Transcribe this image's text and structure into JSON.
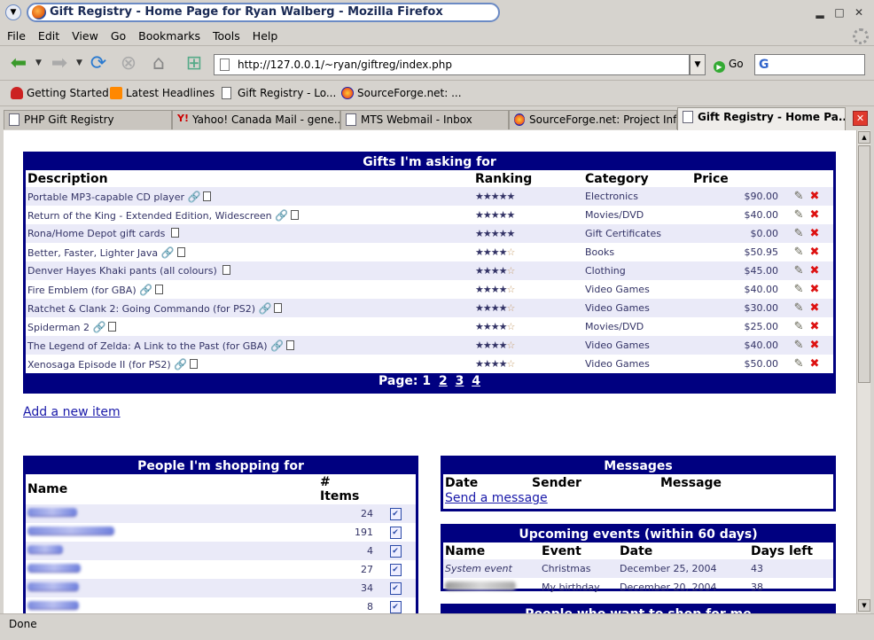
{
  "window": {
    "title": "Gift Registry - Home Page for Ryan Walberg - Mozilla Firefox"
  },
  "menu": [
    "File",
    "Edit",
    "View",
    "Go",
    "Bookmarks",
    "Tools",
    "Help"
  ],
  "nav": {
    "url": "http://127.0.0.1/~ryan/giftreg/index.php",
    "go_label": "Go",
    "search_placeholder": ""
  },
  "bookmarks": [
    {
      "label": "Getting Started",
      "icon": "redhat-icon"
    },
    {
      "label": "Latest Headlines",
      "icon": "rss-icon"
    },
    {
      "label": "Gift Registry - Lo...",
      "icon": "page-icon"
    },
    {
      "label": "SourceForge.net: ...",
      "icon": "firefox-icon"
    }
  ],
  "tabs": [
    {
      "label": "PHP Gift Registry",
      "active": false
    },
    {
      "label": "Yahoo! Canada Mail - gene...",
      "active": false
    },
    {
      "label": "MTS Webmail - Inbox",
      "active": false
    },
    {
      "label": "SourceForge.net: Project Inf...",
      "active": false
    },
    {
      "label": "Gift Registry - Home Pa...",
      "active": true
    }
  ],
  "gifts": {
    "title": "Gifts I'm asking for",
    "headers": {
      "description": "Description",
      "ranking": "Ranking",
      "category": "Category",
      "price": "Price"
    },
    "items": [
      {
        "description": "Portable MP3-capable CD player",
        "link": true,
        "stars": 5,
        "category": "Electronics",
        "price": "$90.00"
      },
      {
        "description": "Return of the King - Extended Edition, Widescreen",
        "link": true,
        "stars": 5,
        "category": "Movies/DVD",
        "price": "$40.00"
      },
      {
        "description": "Rona/Home Depot gift cards",
        "link": false,
        "stars": 5,
        "category": "Gift Certificates",
        "price": "$0.00"
      },
      {
        "description": "Better, Faster, Lighter Java",
        "link": true,
        "stars": 4,
        "category": "Books",
        "price": "$50.95"
      },
      {
        "description": "Denver Hayes Khaki pants (all colours)",
        "link": false,
        "stars": 4,
        "category": "Clothing",
        "price": "$45.00"
      },
      {
        "description": "Fire Emblem (for GBA)",
        "link": true,
        "stars": 4,
        "category": "Video Games",
        "price": "$40.00"
      },
      {
        "description": "Ratchet & Clank 2: Going Commando (for PS2)",
        "link": true,
        "stars": 4,
        "category": "Video Games",
        "price": "$30.00"
      },
      {
        "description": "Spiderman 2",
        "link": true,
        "stars": 4,
        "category": "Movies/DVD",
        "price": "$25.00"
      },
      {
        "description": "The Legend of Zelda: A Link to the Past (for GBA)",
        "link": true,
        "stars": 4,
        "category": "Video Games",
        "price": "$40.00"
      },
      {
        "description": "Xenosaga Episode II (for PS2)",
        "link": true,
        "stars": 4,
        "category": "Video Games",
        "price": "$50.00"
      }
    ],
    "pager": {
      "label": "Page:",
      "current": "1",
      "pages": [
        "2",
        "3",
        "4"
      ]
    }
  },
  "add_item": "Add a new item",
  "shopping": {
    "title": "People I'm shopping for",
    "headers": {
      "name": "Name",
      "items": "# Items"
    },
    "rows": [
      {
        "items": "24"
      },
      {
        "items": "191"
      },
      {
        "items": "4"
      },
      {
        "items": "27"
      },
      {
        "items": "34"
      },
      {
        "items": "8"
      },
      {
        "items": "63"
      }
    ]
  },
  "messages": {
    "title": "Messages",
    "headers": {
      "date": "Date",
      "sender": "Sender",
      "message": "Message"
    },
    "send": "Send a message"
  },
  "events": {
    "title": "Upcoming events (within 60 days)",
    "headers": {
      "name": "Name",
      "event": "Event",
      "date": "Date",
      "days": "Days left"
    },
    "rows": [
      {
        "name": "System event",
        "event": "Christmas",
        "date": "December 25, 2004",
        "days": "43"
      },
      {
        "name": "",
        "event": "My birthday",
        "date": "December 20, 2004",
        "days": "38"
      }
    ]
  },
  "next_panel": {
    "title": "People who want to shop for me"
  },
  "status": "Done"
}
